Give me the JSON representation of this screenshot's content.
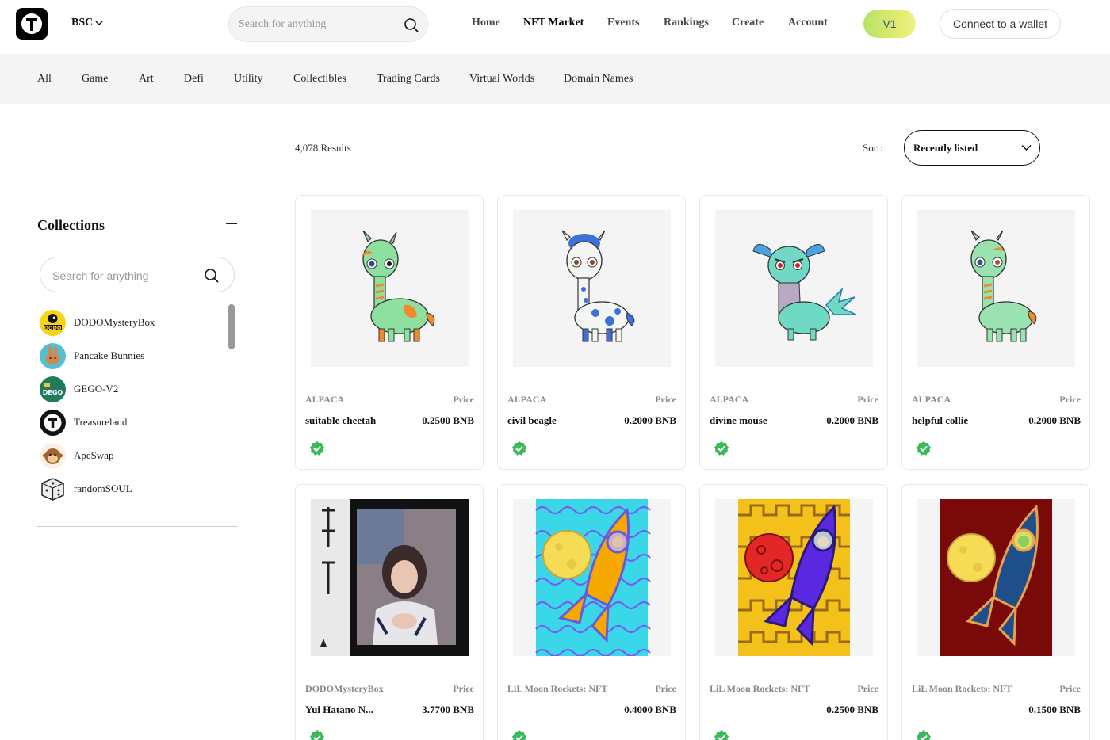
{
  "header": {
    "chain": "BSC",
    "search_placeholder": "Search for anything",
    "nav": [
      "Home",
      "NFT Market",
      "Events",
      "Rankings",
      "Create",
      "Account"
    ],
    "active_nav": "NFT Market",
    "version": "V1",
    "connect_label": "Connect to a wallet"
  },
  "categories": [
    "All",
    "Game",
    "Art",
    "Defi",
    "Utility",
    "Collectibles",
    "Trading Cards",
    "Virtual Worlds",
    "Domain Names"
  ],
  "results": {
    "count": "4,078 Results",
    "sort_label": "Sort:",
    "sort_value": "Recently listed"
  },
  "sidebar": {
    "title": "Collections",
    "search_placeholder": "Search for anything",
    "collections": [
      {
        "name": "DODOMysteryBox",
        "icon": "dodo-logo"
      },
      {
        "name": "Pancake Bunnies",
        "icon": "bunny-logo"
      },
      {
        "name": "GEGO-V2",
        "icon": "dego-logo"
      },
      {
        "name": "Treasureland",
        "icon": "treasureland-logo"
      },
      {
        "name": "ApeSwap",
        "icon": "ape-logo"
      },
      {
        "name": "randomSOUL",
        "icon": "dice-logo"
      }
    ]
  },
  "cards": [
    {
      "collection": "ALPACA",
      "price_label": "Price",
      "name": "suitable cheetah",
      "price": "0.2500 BNB",
      "art": "alpaca-green"
    },
    {
      "collection": "ALPACA",
      "price_label": "Price",
      "name": "civil beagle",
      "price": "0.2000 BNB",
      "art": "alpaca-blue"
    },
    {
      "collection": "ALPACA",
      "price_label": "Price",
      "name": "divine mouse",
      "price": "0.2000 BNB",
      "art": "alpaca-teal"
    },
    {
      "collection": "ALPACA",
      "price_label": "Price",
      "name": "helpful collie",
      "price": "0.2000 BNB",
      "art": "alpaca-mint"
    },
    {
      "collection": "DODOMysteryBox",
      "price_label": "Price",
      "name": "Yui Hatano N...",
      "price": "3.7700 BNB",
      "art": "photo-card"
    },
    {
      "collection": "LiL Moon Rockets: NFT",
      "price_label": "Price",
      "name": "",
      "price": "0.4000 BNB",
      "art": "rocket-orange"
    },
    {
      "collection": "LiL Moon Rockets: NFT",
      "price_label": "Price",
      "name": "",
      "price": "0.2500 BNB",
      "art": "rocket-purple"
    },
    {
      "collection": "LiL Moon Rockets: NFT",
      "price_label": "Price",
      "name": "",
      "price": "0.1500 BNB",
      "art": "rocket-navy"
    }
  ],
  "colors": {
    "accent": "#111111",
    "verified": "#3cb95a",
    "category_bg": "#f4f4f4"
  }
}
